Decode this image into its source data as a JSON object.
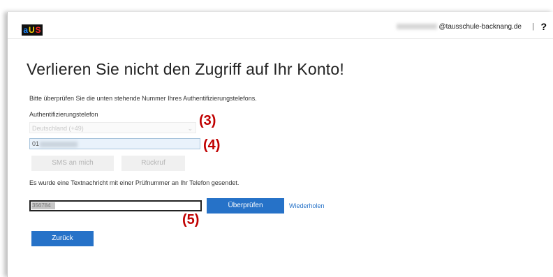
{
  "header": {
    "logo_letters": [
      "a",
      "U",
      "S"
    ],
    "logo_colors": [
      "#1e88ff",
      "#ffd400",
      "#ff2a2a"
    ],
    "user_email": "@tausschule-backnang.de",
    "separator": "|",
    "help": "?"
  },
  "main": {
    "title": "Verlieren Sie nicht den Zugriff auf Ihr Konto!",
    "hint": "Bitte überprüfen Sie die unten stehende Nummer Ihres Authentifizierungstelefons.",
    "phone_label": "Authentifizierungstelefon",
    "country_value": "Deutschland (+49)",
    "phone_prefix": "01",
    "sms_button": "SMS an mich",
    "callback_button": "Rückruf",
    "sent_info": "Es wurde eine Textnachricht mit einer Prüfnummer an Ihr Telefon gesendet.",
    "code_value": "356784",
    "verify_button": "Überprüfen",
    "repeat_link": "Wiederholen",
    "back_button": "Zurück"
  },
  "annotations": {
    "a3": "(3)",
    "a4": "(4)",
    "a5": "(5)"
  },
  "colors": {
    "accent": "#2672c8",
    "annotation": "#c00000"
  }
}
